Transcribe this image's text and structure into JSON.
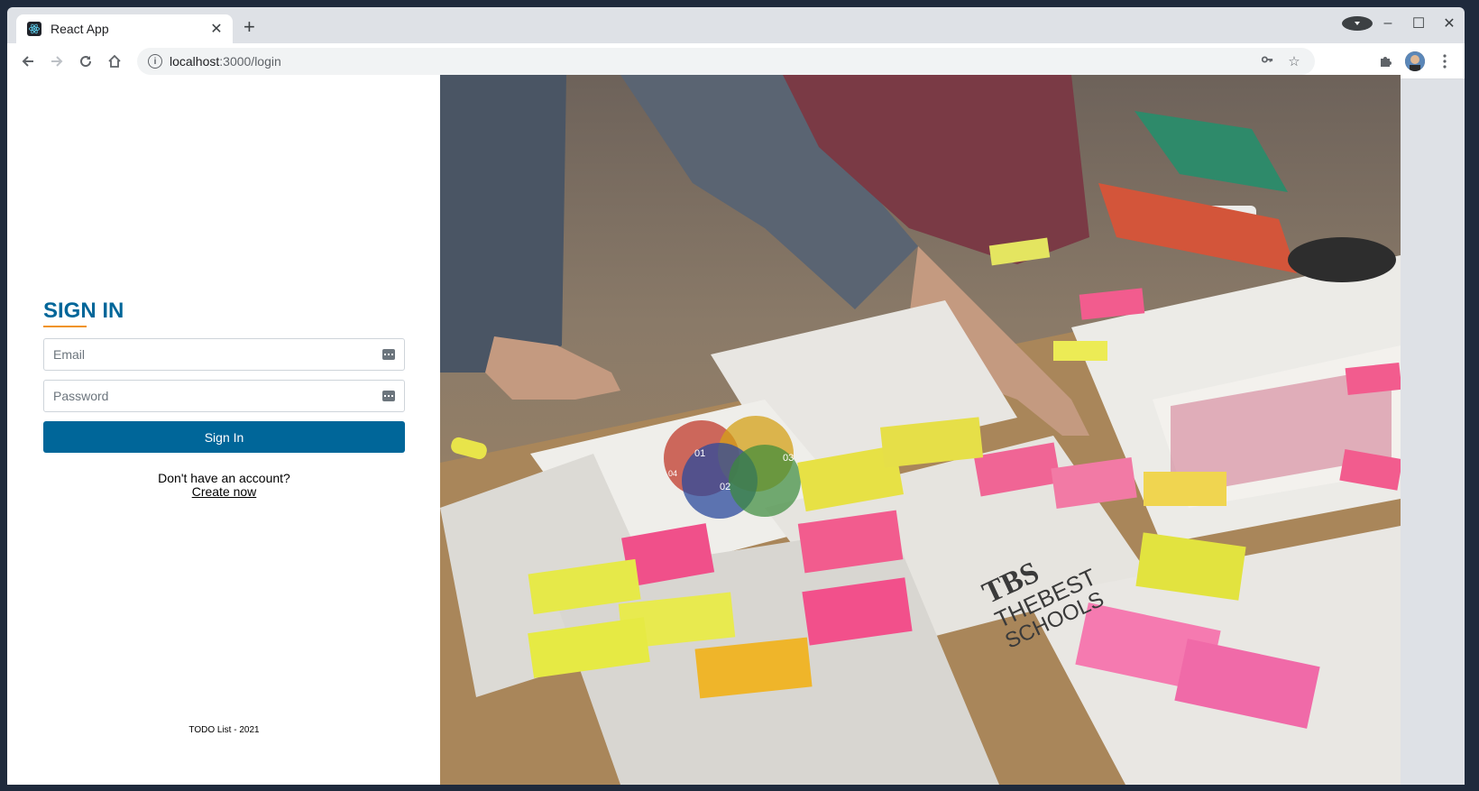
{
  "browser": {
    "tab_title": "React App",
    "url_host": "localhost",
    "url_path": ":3000/login"
  },
  "login": {
    "title": "SIGN IN",
    "email_placeholder": "Email",
    "password_placeholder": "Password",
    "submit_label": "Sign In",
    "no_account_text": "Don't have an account?",
    "create_link": "Create now",
    "footer": "TODO List - 2021"
  },
  "colors": {
    "brand": "#006699",
    "accent": "#f0931b"
  },
  "hero_image": {
    "logo_text_1": "TBS",
    "logo_text_2": "THEBEST",
    "logo_text_3": "SCHOOLS",
    "venn_labels": [
      "01",
      "02",
      "03",
      "04"
    ]
  }
}
